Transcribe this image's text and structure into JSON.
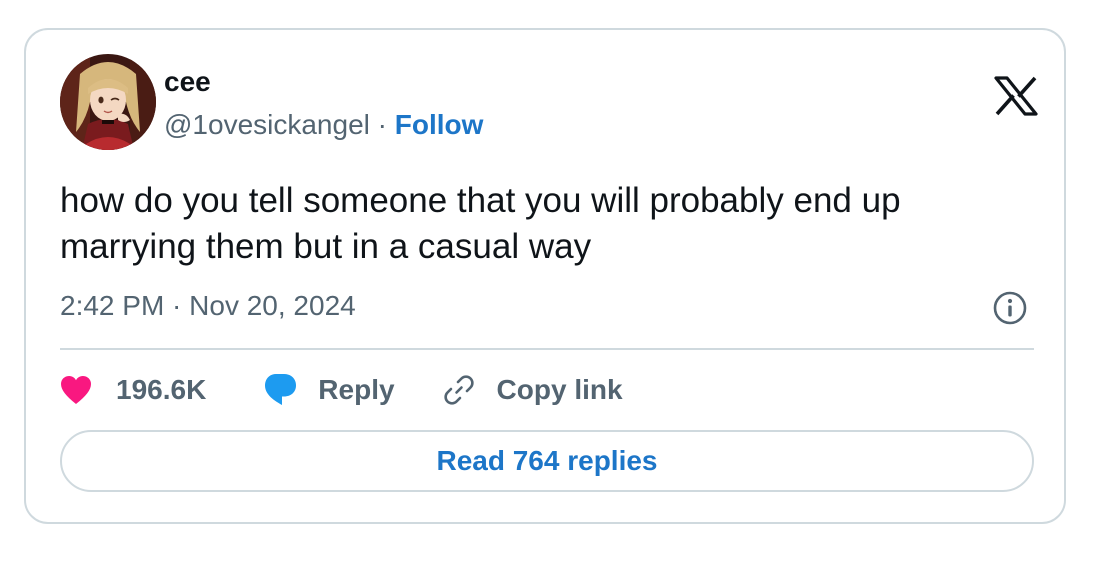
{
  "author": {
    "name": "cee",
    "handle": "@1ovesickangel",
    "separator": "·",
    "follow_label": "Follow",
    "avatar_icon": "profile-avatar"
  },
  "brand": {
    "icon": "x-logo-icon"
  },
  "tweet": {
    "text": "how do you tell someone that you will probably end up marrying them but in a casual way",
    "timestamp": "2:42 PM · Nov 20, 2024"
  },
  "actions": {
    "like_count": "196.6K",
    "reply_label": "Reply",
    "copy_link_label": "Copy link",
    "read_replies_label": "Read 764 replies"
  },
  "colors": {
    "link_blue": "#1d76c8",
    "like_pink": "#f91880",
    "reply_blue": "#1d9bf0",
    "muted": "#536471",
    "border": "#cfd9de"
  }
}
